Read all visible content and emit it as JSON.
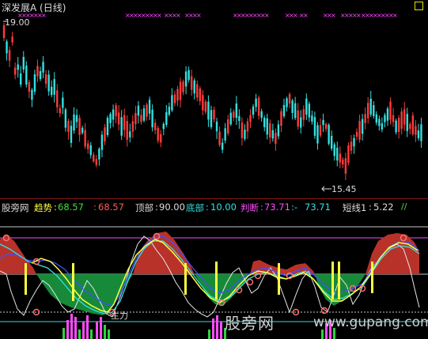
{
  "header": {
    "title": "深发展A (日线)"
  },
  "price_chart": {
    "high_label": "19.00",
    "low_label": "15.45",
    "colors": {
      "up": "#ff3b3b",
      "down": "#34e0e0",
      "marker": "#ff4cff"
    }
  },
  "indicator_bar": {
    "brand": "股旁网",
    "trend_label": "趋势",
    "trend_value": "68.57",
    "second_value": "68.57",
    "top_label": "顶部",
    "top_value": "90.00",
    "bottom_label": "底部",
    "bottom_value": "10.00",
    "judge_label": "判断",
    "judge_value": "73.71",
    "dash_label": ":-",
    "dash_value": "73.71",
    "short_label": "短线1",
    "short_value": "5.22"
  },
  "indicator_chart": {
    "zhuli_label": "主力"
  },
  "watermark": {
    "text": "股旁网",
    "url": "www.gupang.com"
  }
}
